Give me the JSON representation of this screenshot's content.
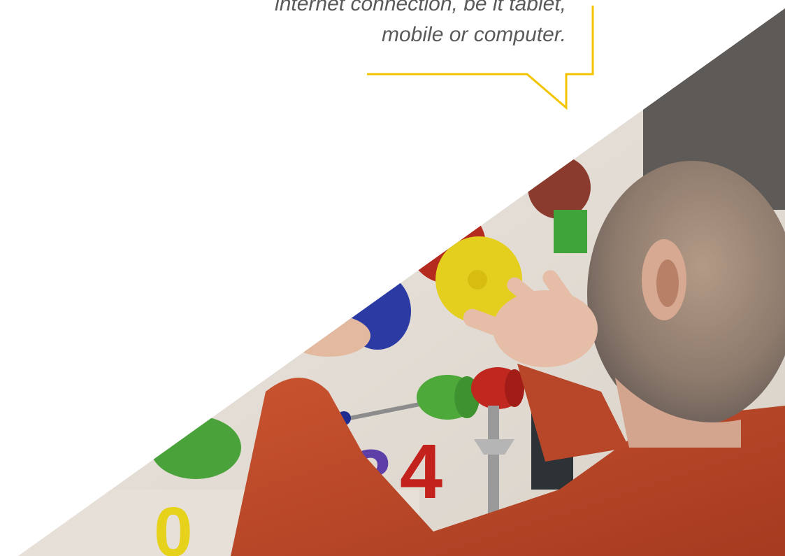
{
  "quote": {
    "line1": "internet connection, be it tablet,",
    "line2": "mobile or computer."
  },
  "colors": {
    "accent": "#F2C500",
    "quote_text": "#5a5a5a",
    "background": "#ffffff"
  }
}
